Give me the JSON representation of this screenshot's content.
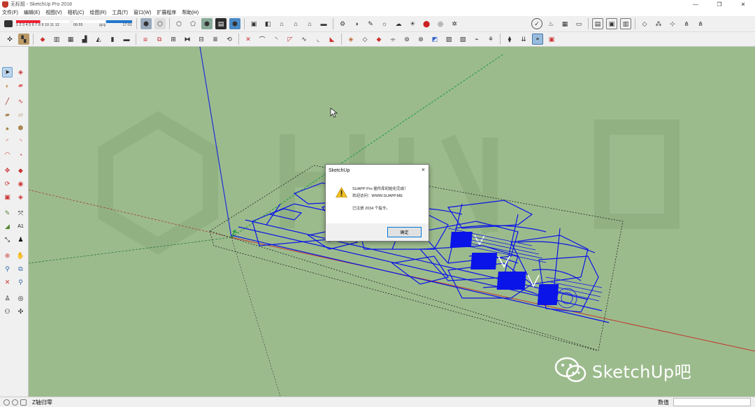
{
  "window": {
    "title": "无标题 - SketchUp Pro 2018",
    "controls": [
      "—",
      "❐",
      "✕"
    ]
  },
  "menu": [
    "文件(F)",
    "编辑(E)",
    "视图(V)",
    "相机(C)",
    "绘图(R)",
    "工具(T)",
    "窗口(W)",
    "扩展程序",
    "帮助(H)"
  ],
  "toolbar": {
    "scale_labels": "1 2 3 4 5 6 7 8 9 10 11 12",
    "time_start": "06:55",
    "time_mid": "中午",
    "time_end": "17:01"
  },
  "dialog": {
    "title": "SketchUp",
    "close": "×",
    "line1": "SUAPP Pro 插件库初始化完成！",
    "line2": "欢迎访问：WWW.SUAPP.ME",
    "line3": "已注册 2034 个指令。",
    "ok_label": "确定"
  },
  "watermark": {
    "text": "SketchUp吧"
  },
  "statusbar": {
    "status_text": "Z轴归零",
    "measurement_label": "数值",
    "measurement_value": ""
  },
  "colors": {
    "viewport": "#9cbb8d",
    "linework": "#0a14e8",
    "axis_red": "#c0392b",
    "axis_green": "#1d9b3a",
    "axis_blue": "#1c2fd8",
    "accent": "#0078d7"
  }
}
